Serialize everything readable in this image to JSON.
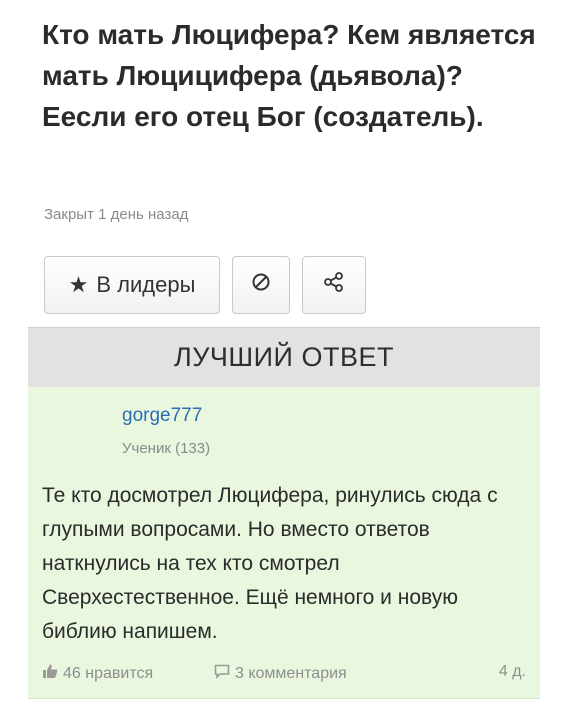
{
  "question": {
    "title": "Кто мать Люцифера? Кем является мать Люцицифера (дьявола)? Еесли его отец Бог (создатель).",
    "status": "Закрыт 1 день назад"
  },
  "actions": {
    "leaders_label": "В лидеры",
    "leaders_icon": "star-icon",
    "block_icon": "block-icon",
    "share_icon": "share-icon"
  },
  "best_answer": {
    "header": "ЛУЧШИЙ ОТВЕТ",
    "author": "gorge777",
    "rank": "Ученик (133)",
    "text": "Те кто досмотрел Люцифера, ринулись сюда с глупыми вопросами. Но вместо ответов наткнулись на тех кто смотрел Сверхестественное. Ещё немного и новую библию напишем.",
    "likes": "46 нравится",
    "comments": "3 комментария",
    "age": "4 д."
  },
  "colors": {
    "accent_link": "#2a6fb3",
    "answer_background": "#e9f7df",
    "header_background": "#e2e2e2"
  }
}
